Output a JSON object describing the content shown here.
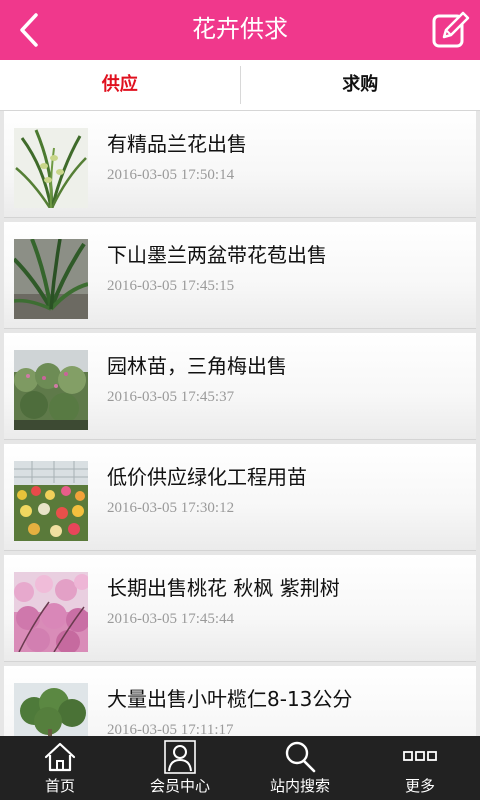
{
  "header": {
    "title": "花卉供求",
    "back_icon": "back-arrow-icon",
    "edit_icon": "edit-note-icon",
    "color": "#f0388c"
  },
  "tabs": [
    {
      "label": "供应",
      "active": true
    },
    {
      "label": "求购",
      "active": false
    }
  ],
  "list": {
    "items": [
      {
        "title": "有精品兰花出售",
        "time": "2016-03-05 17:50:14"
      },
      {
        "title": "下山墨兰两盆带花苞出售",
        "time": "2016-03-05 17:45:15"
      },
      {
        "title": "园林苗，三角梅出售",
        "time": "2016-03-05 17:45:37"
      },
      {
        "title": "低价供应绿化工程用苗",
        "time": "2016-03-05 17:30:12"
      },
      {
        "title": "长期出售桃花 秋枫 紫荆树",
        "time": "2016-03-05 17:45:44"
      },
      {
        "title": "大量出售小叶榄仁8-13公分",
        "time": "2016-03-05 17:11:17"
      }
    ]
  },
  "tabbar": {
    "items": [
      {
        "label": "首页",
        "icon": "home-icon"
      },
      {
        "label": "会员中心",
        "icon": "user-icon"
      },
      {
        "label": "站内搜索",
        "icon": "search-icon"
      },
      {
        "label": "更多",
        "icon": "more-icon"
      }
    ]
  }
}
